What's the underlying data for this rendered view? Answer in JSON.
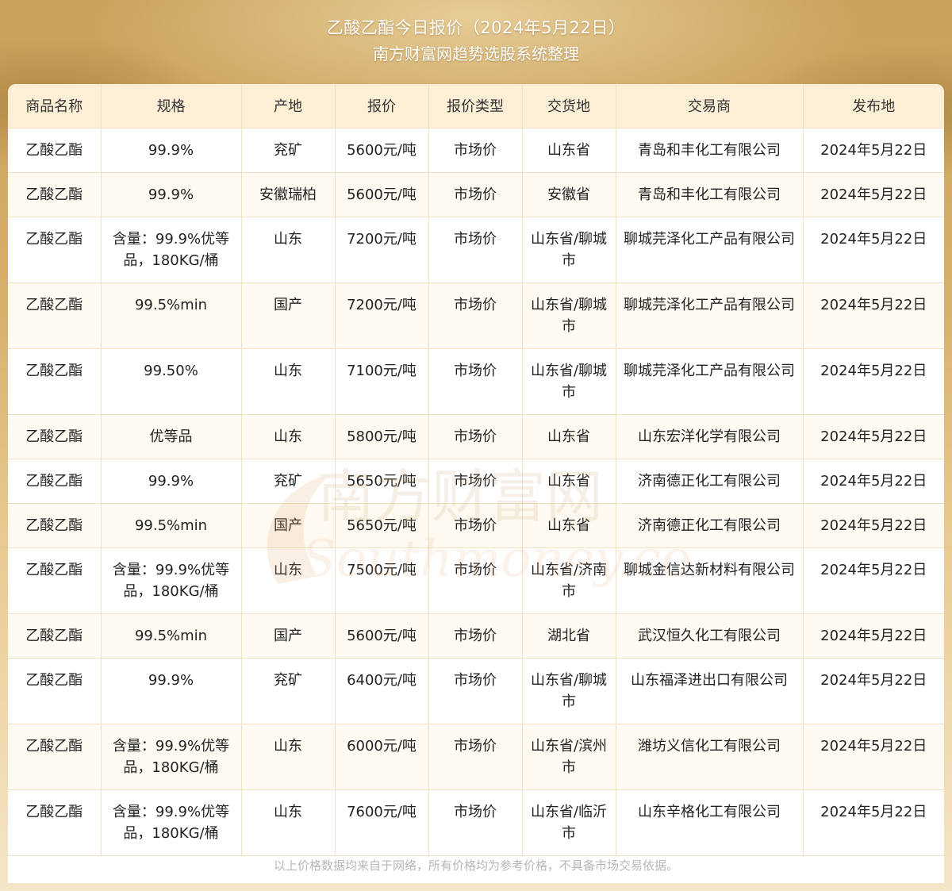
{
  "header": {
    "title": "乙酸乙酯今日报价（2024年5月22日）",
    "subtitle": "南方财富网趋势选股系统整理"
  },
  "table": {
    "columns": [
      "商品名称",
      "规格",
      "产地",
      "报价",
      "报价类型",
      "交货地",
      "交易商",
      "发布地"
    ],
    "rows": [
      {
        "name": "乙酸乙酯",
        "spec": "99.9%",
        "origin": "兖矿",
        "price": "5600元/吨",
        "price_type": "市场价",
        "delivery": "山东省",
        "trader": "青岛和丰化工有限公司",
        "date": "2024年5月22日"
      },
      {
        "name": "乙酸乙酯",
        "spec": "99.9%",
        "origin": "安徽瑞柏",
        "price": "5600元/吨",
        "price_type": "市场价",
        "delivery": "安徽省",
        "trader": "青岛和丰化工有限公司",
        "date": "2024年5月22日"
      },
      {
        "name": "乙酸乙酯",
        "spec": "含量：99.9%优等品，180KG/桶",
        "origin": "山东",
        "price": "7200元/吨",
        "price_type": "市场价",
        "delivery": "山东省/聊城市",
        "trader": "聊城芫泽化工产品有限公司",
        "date": "2024年5月22日"
      },
      {
        "name": "乙酸乙酯",
        "spec": "99.5%min",
        "origin": "国产",
        "price": "7200元/吨",
        "price_type": "市场价",
        "delivery": "山东省/聊城市",
        "trader": "聊城芫泽化工产品有限公司",
        "date": "2024年5月22日"
      },
      {
        "name": "乙酸乙酯",
        "spec": "99.50%",
        "origin": "山东",
        "price": "7100元/吨",
        "price_type": "市场价",
        "delivery": "山东省/聊城市",
        "trader": "聊城芫泽化工产品有限公司",
        "date": "2024年5月22日"
      },
      {
        "name": "乙酸乙酯",
        "spec": "优等品",
        "origin": "山东",
        "price": "5800元/吨",
        "price_type": "市场价",
        "delivery": "山东省",
        "trader": "山东宏洋化学有限公司",
        "date": "2024年5月22日"
      },
      {
        "name": "乙酸乙酯",
        "spec": "99.9%",
        "origin": "兖矿",
        "price": "5650元/吨",
        "price_type": "市场价",
        "delivery": "山东省",
        "trader": "济南德正化工有限公司",
        "date": "2024年5月22日"
      },
      {
        "name": "乙酸乙酯",
        "spec": "99.5%min",
        "origin": "国产",
        "price": "5650元/吨",
        "price_type": "市场价",
        "delivery": "山东省",
        "trader": "济南德正化工有限公司",
        "date": "2024年5月22日"
      },
      {
        "name": "乙酸乙酯",
        "spec": "含量：99.9%优等品，180KG/桶",
        "origin": "山东",
        "price": "7500元/吨",
        "price_type": "市场价",
        "delivery": "山东省/济南市",
        "trader": "聊城金信达新材料有限公司",
        "date": "2024年5月22日"
      },
      {
        "name": "乙酸乙酯",
        "spec": "99.5%min",
        "origin": "国产",
        "price": "5600元/吨",
        "price_type": "市场价",
        "delivery": "湖北省",
        "trader": "武汉恒久化工有限公司",
        "date": "2024年5月22日"
      },
      {
        "name": "乙酸乙酯",
        "spec": "99.9%",
        "origin": "兖矿",
        "price": "6400元/吨",
        "price_type": "市场价",
        "delivery": "山东省/聊城市",
        "trader": "山东福泽进出口有限公司",
        "date": "2024年5月22日"
      },
      {
        "name": "乙酸乙酯",
        "spec": "含量：99.9%优等品，180KG/桶",
        "origin": "山东",
        "price": "6000元/吨",
        "price_type": "市场价",
        "delivery": "山东省/滨州市",
        "trader": "潍坊义信化工有限公司",
        "date": "2024年5月22日"
      },
      {
        "name": "乙酸乙酯",
        "spec": "含量：99.9%优等品，180KG/桶",
        "origin": "山东",
        "price": "7600元/吨",
        "price_type": "市场价",
        "delivery": "山东省/临沂市",
        "trader": "山东辛格化工有限公司",
        "date": "2024年5月22日"
      }
    ]
  },
  "watermark": {
    "cn": "南方财富网",
    "en": "Southmoney.com",
    "color": "#e0b070"
  },
  "footer": "以上价格数据均来自于网络，所有价格均为参考价格，不具备市场交易依据。",
  "colors": {
    "header_bg": "#fcefd6",
    "row_alt": "#fffaf1",
    "border": "#f1e2c6"
  }
}
